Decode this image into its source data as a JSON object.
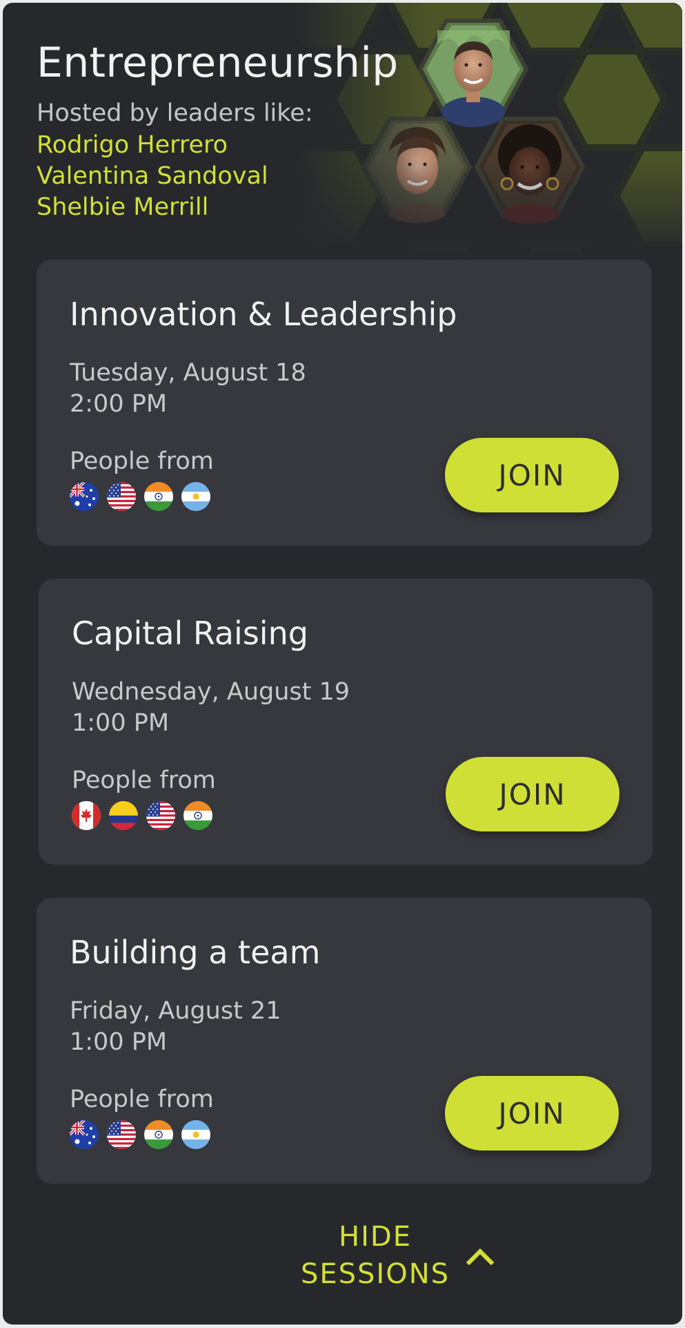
{
  "header": {
    "title": "Entrepreneurship",
    "hosted_label": "Hosted by leaders like:",
    "leaders": [
      "Rodrigo Herrero",
      "Valentina Sandoval",
      "Shelbie Merrill"
    ]
  },
  "sessions": [
    {
      "title": "Innovation & Leadership",
      "date": "Tuesday, August 18",
      "time": "2:00 PM",
      "people_label": "People from",
      "flags": [
        "australia-flag-icon",
        "usa-flag-icon",
        "india-flag-icon",
        "argentina-flag-icon"
      ],
      "join_label": "JOIN"
    },
    {
      "title": "Capital Raising",
      "date": "Wednesday, August 19",
      "time": "1:00 PM",
      "people_label": "People from",
      "flags": [
        "canada-flag-icon",
        "colombia-flag-icon",
        "usa-flag-icon",
        "india-flag-icon"
      ],
      "join_label": "JOIN"
    },
    {
      "title": "Building a team",
      "date": "Friday, August 21",
      "time": "1:00 PM",
      "people_label": "People from",
      "flags": [
        "australia-flag-icon",
        "usa-flag-icon",
        "india-flag-icon",
        "argentina-flag-icon"
      ],
      "join_label": "JOIN"
    }
  ],
  "footer": {
    "hide_line1": "HIDE",
    "hide_line2": "SESSIONS",
    "chevron_icon": "chevron-up-icon"
  },
  "colors": {
    "background": "#26282c",
    "card": "#36383d",
    "accent": "#d4e034",
    "button": "#cfdf35"
  }
}
